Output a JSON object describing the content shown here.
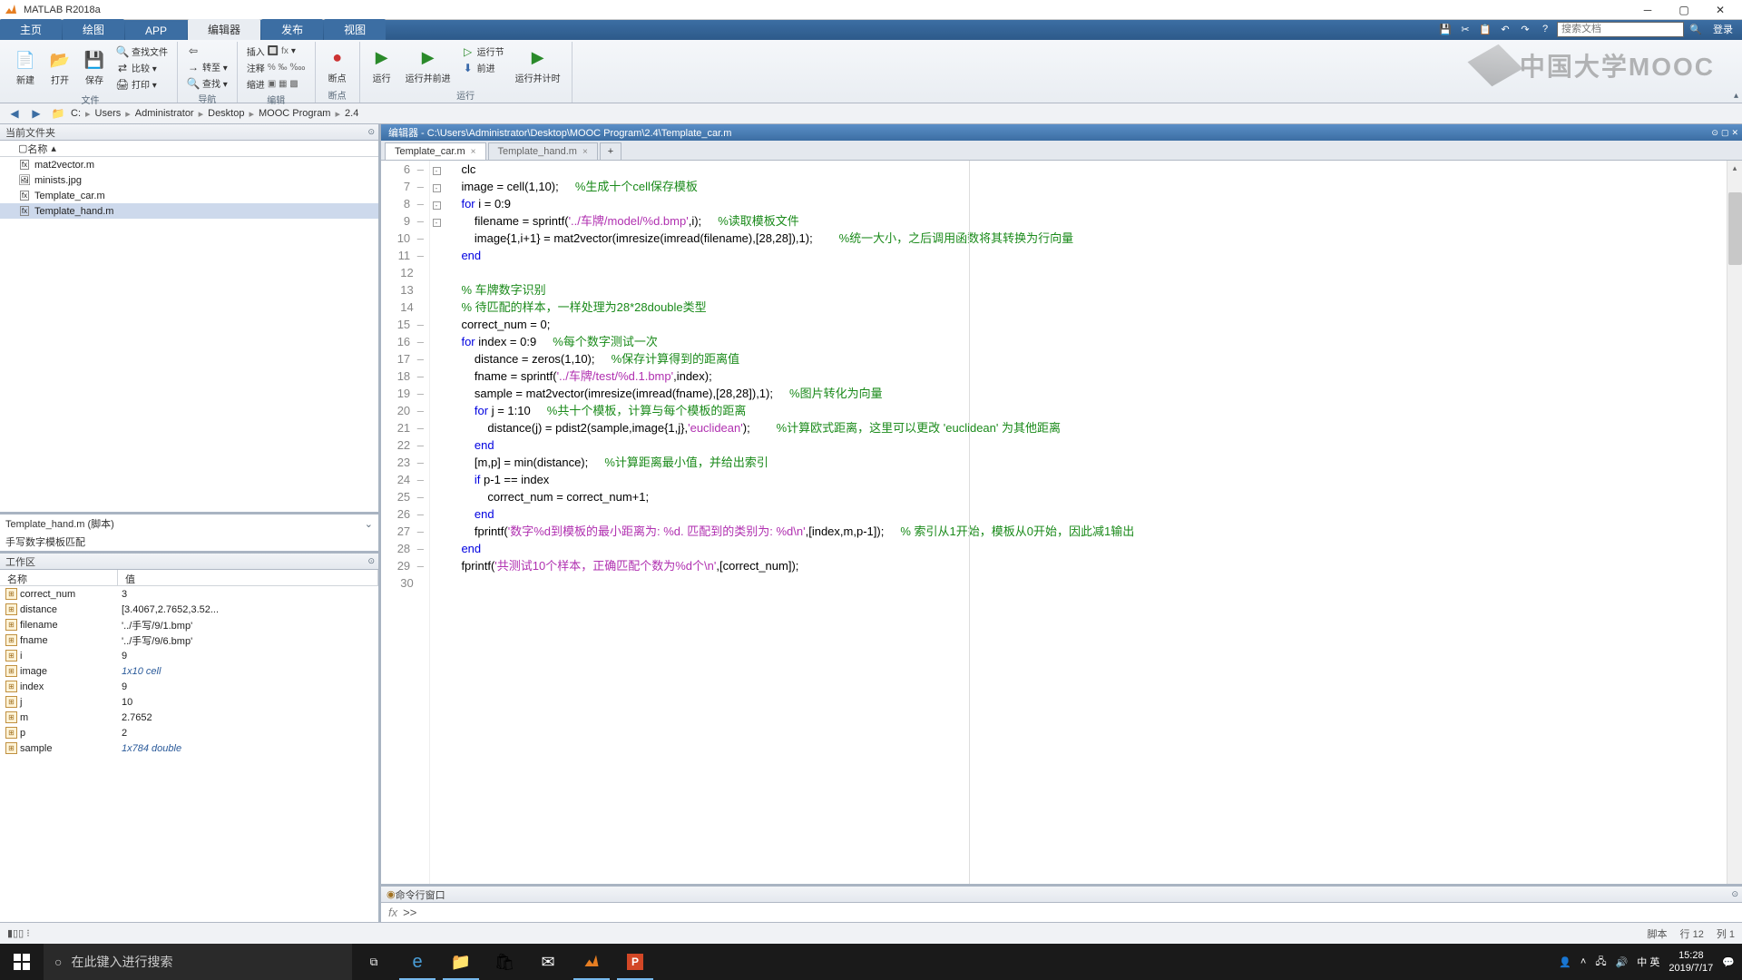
{
  "window": {
    "title": "MATLAB R2018a"
  },
  "tabs": {
    "items": [
      "主页",
      "绘图",
      "APP",
      "编辑器",
      "发布",
      "视图"
    ],
    "active_index": 3,
    "search_placeholder": "搜索文档",
    "login": "登录"
  },
  "ribbon": {
    "groups": [
      {
        "label": "文件",
        "big": [
          {
            "icon": "📄",
            "text": "新建"
          },
          {
            "icon": "📂",
            "text": "打开"
          },
          {
            "icon": "💾",
            "text": "保存"
          }
        ],
        "small": [
          {
            "icon": "🔍",
            "text": "查找文件"
          },
          {
            "icon": "⇄",
            "text": "比较 ▾"
          },
          {
            "icon": "🖨",
            "text": "打印 ▾"
          }
        ]
      },
      {
        "label": "导航",
        "small": [
          {
            "icon": "⇦",
            "text": ""
          },
          {
            "icon": "→",
            "text": "转至 ▾"
          },
          {
            "icon": "🔍",
            "text": "查找 ▾"
          }
        ]
      },
      {
        "label": "编辑",
        "small2": [
          {
            "text": "插入"
          },
          {
            "text": "注释"
          },
          {
            "text": "缩进"
          }
        ],
        "side": [
          {
            "t": "🔲 fx"
          },
          {
            "t": "% ‰ ‱"
          },
          {
            "t": "▣ ▦ ▩"
          }
        ]
      },
      {
        "label": "断点",
        "big": [
          {
            "icon": "🔴",
            "text": "断点"
          }
        ]
      },
      {
        "label": "运行",
        "big": [
          {
            "icon": "▶",
            "text": "运行"
          },
          {
            "icon": "▶|",
            "text": "运行并前进"
          },
          {
            "icon": "▶⏱",
            "text": "运行并计时"
          }
        ],
        "small": [
          {
            "icon": "▷",
            "text": "运行节"
          },
          {
            "icon": "⬇",
            "text": "前进"
          }
        ]
      }
    ],
    "watermark": "中国大学MOOC"
  },
  "breadcrumb": {
    "parts": [
      "C:",
      "Users",
      "Administrator",
      "Desktop",
      "MOOC Program",
      "2.4"
    ]
  },
  "current_folder": {
    "title": "当前文件夹",
    "col_name": "名称",
    "files": [
      {
        "icon": "fx",
        "name": "mat2vector.m"
      },
      {
        "icon": "img",
        "name": "minists.jpg"
      },
      {
        "icon": "fx",
        "name": "Template_car.m"
      },
      {
        "icon": "fx",
        "name": "Template_hand.m",
        "selected": true
      }
    ]
  },
  "details": {
    "file": "Template_hand.m  (脚本)",
    "desc": "手写数字模板匹配"
  },
  "workspace": {
    "title": "工作区",
    "cols": {
      "name": "名称",
      "value": "值"
    },
    "vars": [
      {
        "name": "correct_num",
        "value": "3"
      },
      {
        "name": "distance",
        "value": "[3.4067,2.7652,3.52..."
      },
      {
        "name": "filename",
        "value": "'../手写/9/1.bmp'"
      },
      {
        "name": "fname",
        "value": "'../手写/9/6.bmp'"
      },
      {
        "name": "i",
        "value": "9"
      },
      {
        "name": "image",
        "value": "1x10 cell",
        "italic": true
      },
      {
        "name": "index",
        "value": "9"
      },
      {
        "name": "j",
        "value": "10"
      },
      {
        "name": "m",
        "value": "2.7652"
      },
      {
        "name": "p",
        "value": "2"
      },
      {
        "name": "sample",
        "value": "1x784 double",
        "italic": true
      }
    ]
  },
  "editor": {
    "title": "编辑器 - C:\\Users\\Administrator\\Desktop\\MOOC Program\\2.4\\Template_car.m",
    "tabs": [
      {
        "name": "Template_car.m",
        "active": true
      },
      {
        "name": "Template_hand.m",
        "active": false
      }
    ],
    "lines": [
      {
        "n": 6,
        "dash": true,
        "code": "    clc"
      },
      {
        "n": 7,
        "dash": true,
        "code": "    image = cell(1,10);     <com>%生成十个cell保存模板</com>"
      },
      {
        "n": 8,
        "dash": true,
        "fold": "-",
        "code": "    <kw>for</kw> i = 0:9"
      },
      {
        "n": 9,
        "dash": true,
        "code": "        filename = sprintf(<str>'../车牌/model/%d.bmp'</str>,i);     <com>%读取模板文件</com>"
      },
      {
        "n": 10,
        "dash": true,
        "code": "        image{1,i+1} = mat2vector(imresize(imread(filename),[28,28]),1);        <com>%统一大小，之后调用函数将其转换为行向量</com>"
      },
      {
        "n": 11,
        "dash": true,
        "code": "    <kw>end</kw>"
      },
      {
        "n": 12,
        "dash": false,
        "code": ""
      },
      {
        "n": 13,
        "dash": false,
        "code": "    <com>% 车牌数字识别</com>"
      },
      {
        "n": 14,
        "dash": false,
        "code": "    <com>% 待匹配的样本，一样处理为28*28double类型</com>"
      },
      {
        "n": 15,
        "dash": true,
        "code": "    correct_num = 0;"
      },
      {
        "n": 16,
        "dash": true,
        "fold": "-",
        "code": "    <kw>for</kw> index = 0:9     <com>%每个数字测试一次</com>"
      },
      {
        "n": 17,
        "dash": true,
        "code": "        distance = zeros(1,10);     <com>%保存计算得到的距离值</com>"
      },
      {
        "n": 18,
        "dash": true,
        "code": "        fname = sprintf(<str>'../车牌/test/%d.1.bmp'</str>,index);"
      },
      {
        "n": 19,
        "dash": true,
        "code": "        sample = mat2vector(imresize(imread(fname),[28,28]),1);     <com>%图片转化为向量</com>"
      },
      {
        "n": 20,
        "dash": true,
        "fold": "-",
        "code": "        <kw>for</kw> j = 1:10     <com>%共十个模板，计算与每个模板的距离</com>"
      },
      {
        "n": 21,
        "dash": true,
        "code": "            distance(j) = pdist2(sample,image{1,j},<str>'euclidean'</str>);        <com>%计算欧式距离，这里可以更改 'euclidean' 为其他距离</com>"
      },
      {
        "n": 22,
        "dash": true,
        "code": "        <kw>end</kw>"
      },
      {
        "n": 23,
        "dash": true,
        "code": "        [m,p] = min(distance);     <com>%计算距离最小值，并给出索引</com>"
      },
      {
        "n": 24,
        "dash": true,
        "fold": "-",
        "code": "        <kw>if</kw> p-1 == index"
      },
      {
        "n": 25,
        "dash": true,
        "code": "            correct_num = correct_num+1;"
      },
      {
        "n": 26,
        "dash": true,
        "code": "        <kw>end</kw>"
      },
      {
        "n": 27,
        "dash": true,
        "code": "        fprintf(<str>'数字%d到模板的最小距离为: %d. 匹配到的类别为: %d\\n'</str>,[index,m,p-1]);     <com>% 索引从1开始，模板从0开始，因此减1输出</com>"
      },
      {
        "n": 28,
        "dash": true,
        "code": "    <kw>end</kw>"
      },
      {
        "n": 29,
        "dash": true,
        "code": "    fprintf(<str>'共测试10个样本，正确匹配个数为%d个\\n'</str>,[correct_num]);"
      },
      {
        "n": 30,
        "dash": false,
        "code": ""
      }
    ]
  },
  "command": {
    "title": "命令行窗口",
    "prompt": ">>"
  },
  "statusbar": {
    "mode": "脚本",
    "line": "行 12",
    "col": "列 1"
  },
  "taskbar": {
    "search_placeholder": "在此键入进行搜索",
    "time": "15:28",
    "date": "2019/7/17",
    "ime": "中 英"
  }
}
